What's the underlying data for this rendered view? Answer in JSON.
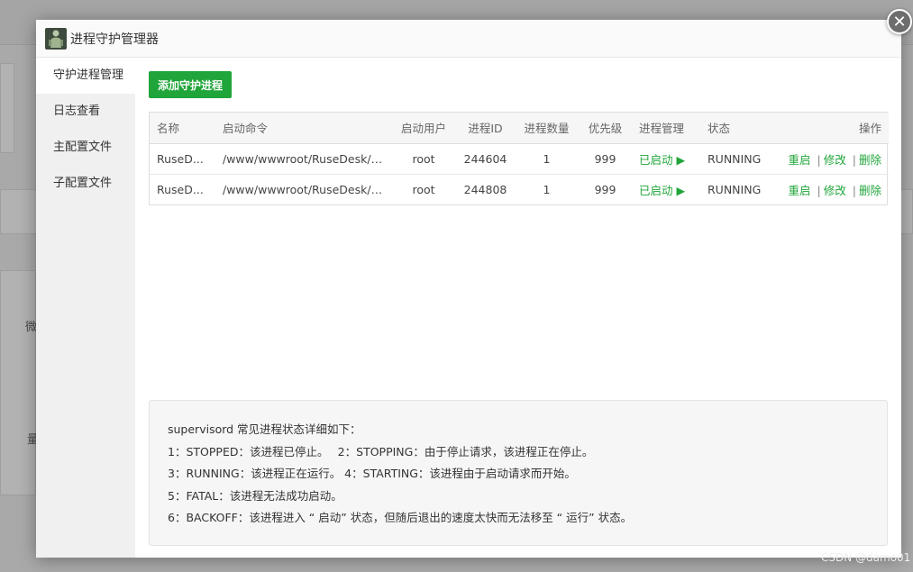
{
  "dialog": {
    "title": "进程守护管理器",
    "close_label": "✕"
  },
  "sidebar": {
    "items": [
      {
        "label": "守护进程管理"
      },
      {
        "label": "日志查看"
      },
      {
        "label": "主配置文件"
      },
      {
        "label": "子配置文件"
      }
    ]
  },
  "toolbar": {
    "add_label": "添加守护进程"
  },
  "table": {
    "headers": [
      "名称",
      "启动命令",
      "启动用户",
      "进程ID",
      "进程数量",
      "优先级",
      "进程管理",
      "状态",
      "操作"
    ],
    "rows": [
      {
        "name": "RuseD...",
        "command": "/www/wwwroot/RuseDesk/h...",
        "user": "root",
        "pid": "244604",
        "count": "1",
        "priority": "999",
        "manage": "已启动 ▶",
        "status": "RUNNING",
        "ops": [
          "重启",
          "修改",
          "删除"
        ]
      },
      {
        "name": "RuseD...",
        "command": "/www/wwwroot/RuseDesk/h...",
        "user": "root",
        "pid": "244808",
        "count": "1",
        "priority": "999",
        "manage": "已启动 ▶",
        "status": "RUNNING",
        "ops": [
          "重启",
          "修改",
          "删除"
        ]
      }
    ],
    "op_separator": "|"
  },
  "info": {
    "lines": [
      "supervisord 常见进程状态详细如下：",
      "1：STOPPED：该进程已停止。　 2：STOPPING：由于停止请求，该进程正在停止。",
      "3：RUNNING：该进程正在运行。 4：STARTING：该进程由于启动请求而开始。",
      "5：FATAL：该进程无法成功启动。",
      "6：BACKOFF：该进程进入 “ 启动” 状态，但随后退出的速度太快而无法移至 “ 运行” 状态。"
    ]
  },
  "background": {
    "side_chars": [
      "微",
      "量"
    ]
  },
  "watermark": "CSDN @damo01",
  "colors": {
    "accent": "#20a53a",
    "overlay": "rgba(0,0,0,0.30)"
  }
}
